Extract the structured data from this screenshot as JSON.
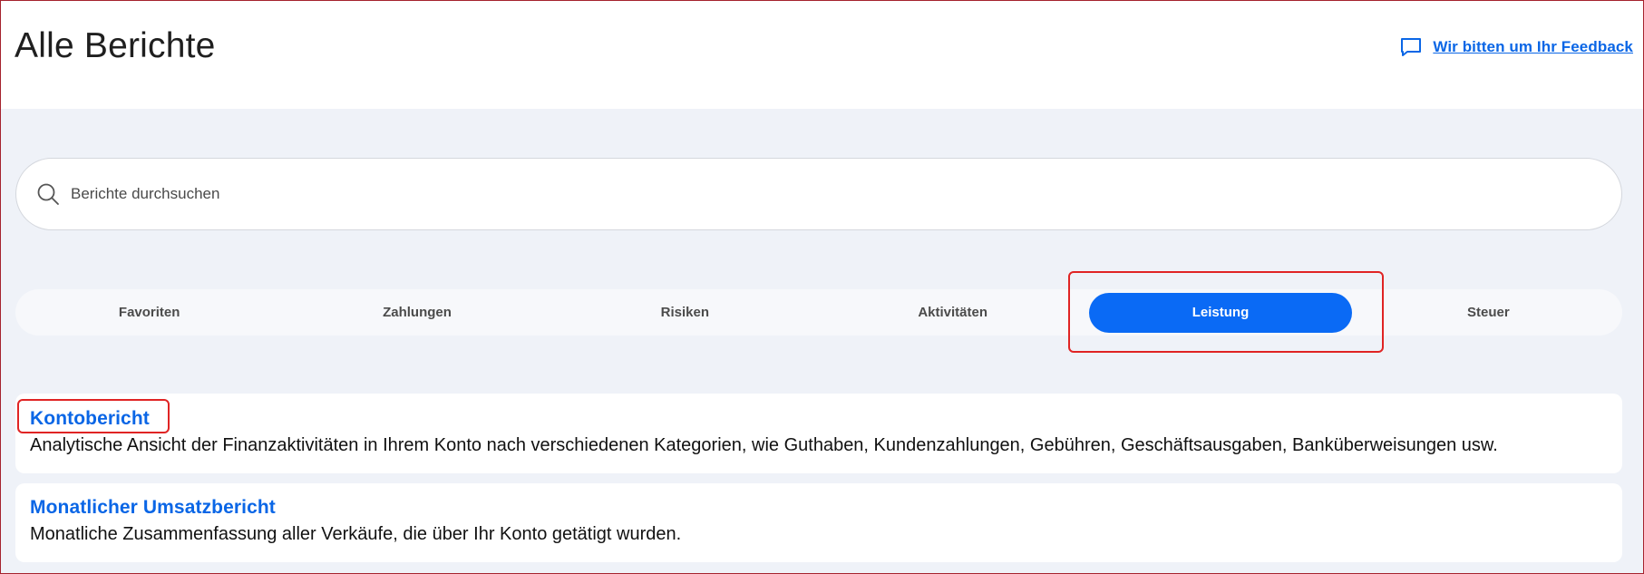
{
  "header": {
    "title": "Alle Berichte",
    "feedback_label": "Wir bitten um Ihr Feedback",
    "feedback_icon": "chat-bubble-icon"
  },
  "search": {
    "icon": "search-icon",
    "placeholder": "Berichte durchsuchen",
    "value": ""
  },
  "tabs": [
    {
      "label": "Favoriten",
      "active": false
    },
    {
      "label": "Zahlungen",
      "active": false
    },
    {
      "label": "Risiken",
      "active": false
    },
    {
      "label": "Aktivitäten",
      "active": false
    },
    {
      "label": "Leistung",
      "active": true
    },
    {
      "label": "Steuer",
      "active": false
    }
  ],
  "reports": [
    {
      "title": "Kontobericht",
      "description": "Analytische Ansicht der Finanzaktivitäten in Ihrem Konto nach verschiedenen Kategorien, wie Guthaben, Kundenzahlungen, Gebühren, Geschäftsausgaben, Banküberweisungen usw."
    },
    {
      "title": "Monatlicher Umsatzbericht",
      "description": "Monatliche Zusammenfassung aller Verkäufe, die über Ihr Konto getätigt wurden."
    }
  ],
  "colors": {
    "accent": "#0a6af5",
    "link": "#0a66e6",
    "highlight": "#e02424",
    "background": "#eff2f8"
  }
}
